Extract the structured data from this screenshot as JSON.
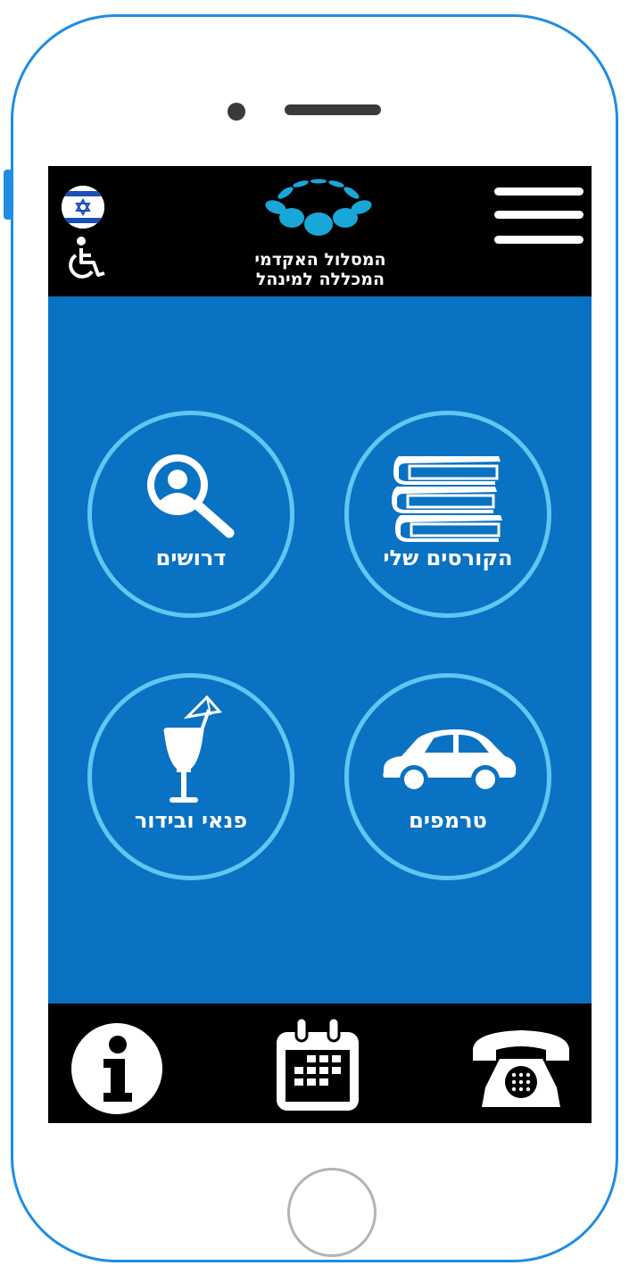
{
  "app": {
    "brand_line1": "המסלול האקדמי",
    "brand_line2": "המכללה למינהל",
    "accent_color": "#0a72c2",
    "ring_color": "#5fc7f0"
  },
  "header": {
    "language_flag": "israel-flag-icon",
    "accessibility": "wheelchair-icon",
    "menu": "hamburger-menu-icon"
  },
  "tiles": [
    {
      "label": "הקורסים שלי",
      "icon": "books-icon"
    },
    {
      "label": "דרושים",
      "icon": "search-person-icon"
    },
    {
      "label": "טרמפים",
      "icon": "car-icon"
    },
    {
      "label": "פנאי ובידור",
      "icon": "cocktail-icon"
    }
  ],
  "footer": {
    "info": "info-icon",
    "calendar": "calendar-icon",
    "contact": "telephone-icon"
  }
}
